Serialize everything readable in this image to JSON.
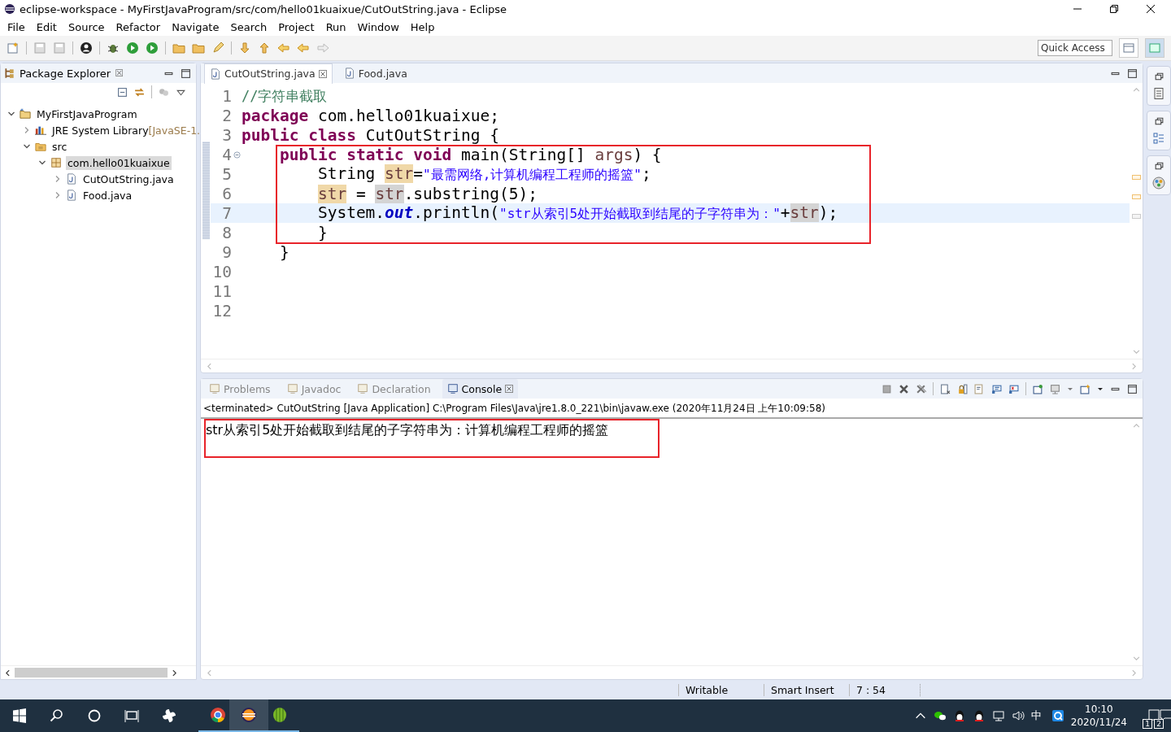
{
  "window": {
    "title": "eclipse-workspace - MyFirstJavaProgram/src/com/hello01kuaixue/CutOutString.java - Eclipse"
  },
  "menu": [
    "File",
    "Edit",
    "Source",
    "Refactor",
    "Navigate",
    "Search",
    "Project",
    "Run",
    "Window",
    "Help"
  ],
  "quick_access": {
    "placeholder": "Quick Access"
  },
  "explorer": {
    "title": "Package Explorer",
    "close": "☒",
    "tree": [
      {
        "label": "MyFirstJavaProgram",
        "kind": "project",
        "expanded": true,
        "selected": false,
        "children": [
          {
            "label": "JRE System Library",
            "suffix": "[JavaSE-1.",
            "kind": "library",
            "expanded": false,
            "selected": false
          },
          {
            "label": "src",
            "kind": "folder",
            "expanded": true,
            "selected": false,
            "children": [
              {
                "label": "com.hello01kuaixue",
                "kind": "package",
                "expanded": true,
                "selected": true,
                "children": [
                  {
                    "label": "CutOutString.java",
                    "kind": "file",
                    "expanded": false,
                    "selected": false
                  },
                  {
                    "label": "Food.java",
                    "kind": "file",
                    "expanded": false,
                    "selected": false
                  }
                ]
              }
            ]
          }
        ]
      }
    ]
  },
  "editor": {
    "tabs": [
      {
        "label": "CutOutString.java",
        "selected": true,
        "closable": true
      },
      {
        "label": "Food.java",
        "selected": false,
        "closable": false
      }
    ],
    "lines": [
      {
        "num": "1",
        "current": false,
        "collapsible": false,
        "tokens": [
          {
            "kind": "comment",
            "text": "//字符串截取"
          }
        ]
      },
      {
        "num": "2",
        "current": false,
        "collapsible": false,
        "tokens": [
          {
            "kind": "keyword",
            "text": "package"
          },
          {
            "kind": "plain",
            "text": " com.hello01kuaixue;"
          }
        ]
      },
      {
        "num": "3",
        "current": false,
        "collapsible": false,
        "tokens": [
          {
            "kind": "keyword",
            "text": "public class"
          },
          {
            "kind": "plain",
            "text": " CutOutString {"
          }
        ]
      },
      {
        "num": "4",
        "current": false,
        "collapsible": true,
        "tokens": [
          {
            "kind": "keyword",
            "text": "    public static void"
          },
          {
            "kind": "plain",
            "text": " main(String[] "
          },
          {
            "kind": "param",
            "text": "args"
          },
          {
            "kind": "plain",
            "text": ") {"
          }
        ]
      },
      {
        "num": "5",
        "current": false,
        "collapsible": false,
        "tokens": [
          {
            "kind": "plain",
            "text": "        String "
          },
          {
            "kind": "write",
            "text": "str"
          },
          {
            "kind": "plain",
            "text": "="
          },
          {
            "kind": "string",
            "text": "\"最需网络,计算机编程工程师的摇篮\""
          },
          {
            "kind": "plain",
            "text": ";"
          }
        ]
      },
      {
        "num": "6",
        "current": false,
        "collapsible": false,
        "tokens": [
          {
            "kind": "write",
            "text": "        str"
          },
          {
            "kind": "plain",
            "text": " = "
          },
          {
            "kind": "read",
            "text": "str"
          },
          {
            "kind": "plain",
            "text": ".substring(5);"
          }
        ]
      },
      {
        "num": "7",
        "current": true,
        "collapsible": false,
        "tokens": [
          {
            "kind": "plain",
            "text": "        System."
          },
          {
            "kind": "field",
            "text": "out"
          },
          {
            "kind": "plain",
            "text": ".println("
          },
          {
            "kind": "string",
            "text": "\"str从索引5处开始截取到结尾的子字符串为：\""
          },
          {
            "kind": "plain",
            "text": "+"
          },
          {
            "kind": "read",
            "text": "str"
          },
          {
            "kind": "plain",
            "text": ");"
          }
        ]
      },
      {
        "num": "8",
        "current": false,
        "collapsible": false,
        "tokens": [
          {
            "kind": "plain",
            "text": "        }"
          }
        ]
      },
      {
        "num": "9",
        "current": false,
        "collapsible": false,
        "tokens": [
          {
            "kind": "plain",
            "text": "    }"
          }
        ]
      },
      {
        "num": "10",
        "current": false,
        "collapsible": false
      },
      {
        "num": "11",
        "current": false,
        "collapsible": false
      },
      {
        "num": "12",
        "current": false,
        "collapsible": false
      }
    ]
  },
  "bottom": {
    "tabs": [
      {
        "label": "Problems",
        "selected": false,
        "closable": false
      },
      {
        "label": "Javadoc",
        "selected": false,
        "closable": false
      },
      {
        "label": "Declaration",
        "selected": false,
        "closable": false
      },
      {
        "label": "Console",
        "selected": true,
        "closable": true
      }
    ],
    "console_header": "<terminated> CutOutString [Java Application] C:\\Program Files\\Java\\jre1.8.0_221\\bin\\javaw.exe (2020年11月24日 上午10:09:58)",
    "console_output": "str从索引5处开始截取到结尾的子字符串为：计算机编程工程师的摇篮"
  },
  "status_bar": [
    "Writable",
    "Smart Insert",
    "7 : 54"
  ],
  "taskbar": {
    "ime": "中",
    "time": "10:10",
    "date": "2020/11/24",
    "badges": [
      "1",
      "2"
    ]
  }
}
